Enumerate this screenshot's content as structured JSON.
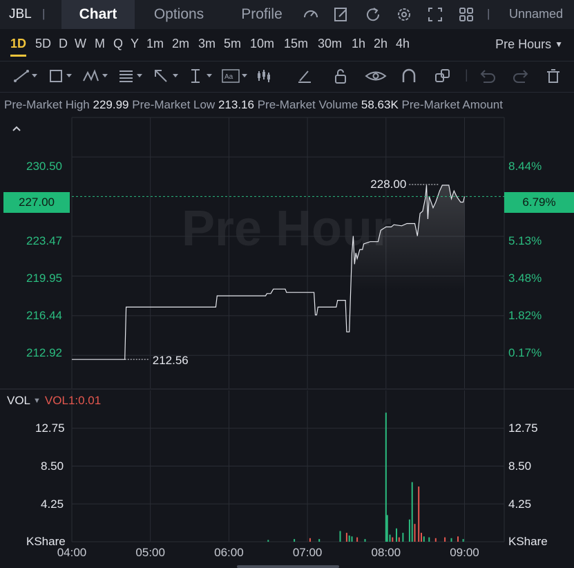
{
  "header": {
    "symbol": "JBL",
    "tabs": [
      {
        "label": "Chart",
        "active": true
      },
      {
        "label": "Options",
        "active": false
      },
      {
        "label": "Profile",
        "active": false
      }
    ],
    "icons": [
      "gauge-icon",
      "edit-icon",
      "refresh-icon",
      "settings-icon",
      "fullscreen-icon",
      "layout-grid-icon"
    ],
    "layout_name": "Unnamed"
  },
  "timeframes": {
    "items": [
      "1D",
      "5D",
      "D",
      "W",
      "M",
      "Q",
      "Y",
      "1m",
      "2m",
      "3m",
      "5m",
      "10m",
      "15m",
      "30m",
      "1h",
      "2h",
      "4h"
    ],
    "active": "1D",
    "session": "Pre Hours"
  },
  "drawing_tools": [
    "trendline-tool-icon",
    "rectangle-tool-icon",
    "pattern-tool-icon",
    "fib-tool-icon",
    "arrow-tool-icon",
    "measure-tool-icon",
    "text-tool-icon",
    "indicator-tool-icon",
    "brush-icon",
    "unlock-icon",
    "eye-icon",
    "magnet-icon",
    "clone-icon",
    "undo-icon",
    "redo-icon",
    "trash-icon"
  ],
  "stats": {
    "high_label": "Pre-Market High",
    "high_value": "229.99",
    "low_label": "Pre-Market Low",
    "low_value": "213.16",
    "volume_label": "Pre-Market Volume",
    "volume_value": "58.63K",
    "amount_label": "Pre-Market Amount"
  },
  "chart_data": {
    "type": "line",
    "watermark": "Pre Hour",
    "current_price": "227.00",
    "current_change": "6.79%",
    "high_marker": "228.00",
    "low_marker": "212.56",
    "price_ticks": [
      "230.50",
      "223.47",
      "219.95",
      "216.44",
      "212.92"
    ],
    "percent_ticks": [
      "8.44%",
      "5.13%",
      "3.48%",
      "1.82%",
      "0.17%"
    ],
    "ylim": [
      210.0,
      234.0
    ],
    "x_ticks": [
      "04:00",
      "05:00",
      "06:00",
      "07:00",
      "08:00",
      "09:00"
    ],
    "x_minutes_range": [
      0,
      330
    ],
    "price_series": [
      [
        0,
        212.56
      ],
      [
        40.5,
        212.56
      ],
      [
        41.5,
        217.2
      ],
      [
        110,
        217.2
      ],
      [
        111,
        218.2
      ],
      [
        148,
        218.2
      ],
      [
        149,
        218.4
      ],
      [
        152,
        218.4
      ],
      [
        154,
        218.8
      ],
      [
        163,
        218.8
      ],
      [
        164,
        218.5
      ],
      [
        185,
        218.5
      ],
      [
        186,
        216.5
      ],
      [
        187,
        216.5
      ],
      [
        188,
        217.2
      ],
      [
        202,
        217.2
      ],
      [
        203,
        217.8
      ],
      [
        209,
        217.8
      ],
      [
        210,
        215.0
      ],
      [
        212,
        215.0
      ],
      [
        214,
        222.0
      ],
      [
        215,
        223.5
      ],
      [
        216,
        221.0
      ],
      [
        217,
        222.0
      ],
      [
        218,
        221.5
      ],
      [
        220,
        222.3
      ],
      [
        222,
        222.3
      ],
      [
        223,
        222.8
      ],
      [
        228,
        223.0
      ],
      [
        234,
        223.0
      ],
      [
        236,
        224.0
      ],
      [
        240,
        224.3
      ],
      [
        244,
        224.3
      ],
      [
        246,
        224.5
      ],
      [
        252,
        224.4
      ],
      [
        256,
        224.6
      ],
      [
        262,
        224.6
      ],
      [
        264,
        223.5
      ],
      [
        266,
        225.5
      ],
      [
        268,
        225.7
      ],
      [
        270,
        226.8
      ],
      [
        271,
        228.0
      ],
      [
        272,
        225.0
      ],
      [
        273,
        227.0
      ],
      [
        276,
        226.0
      ],
      [
        278,
        226.5
      ],
      [
        281,
        227.5
      ],
      [
        283,
        228.0
      ],
      [
        288,
        228.0
      ],
      [
        290,
        226.8
      ],
      [
        292,
        227.5
      ],
      [
        294,
        227.0
      ],
      [
        297,
        226.5
      ],
      [
        299,
        226.5
      ],
      [
        300,
        227.0
      ]
    ],
    "volume_ticks": [
      "12.75",
      "8.50",
      "4.25"
    ],
    "volume_unit": "KShare",
    "volume_legend": "VOL",
    "volume_legend_value": "VOL1:0.01",
    "volume_ylim": [
      0,
      17.0
    ],
    "volume_bars": [
      {
        "t": 150,
        "v": 0.2,
        "dir": "up"
      },
      {
        "t": 170,
        "v": 0.3,
        "dir": "up"
      },
      {
        "t": 182,
        "v": 0.4,
        "dir": "down"
      },
      {
        "t": 189,
        "v": 0.3,
        "dir": "up"
      },
      {
        "t": 205,
        "v": 1.2,
        "dir": "up"
      },
      {
        "t": 210,
        "v": 1.0,
        "dir": "down"
      },
      {
        "t": 212,
        "v": 0.7,
        "dir": "up"
      },
      {
        "t": 214,
        "v": 0.6,
        "dir": "up"
      },
      {
        "t": 218,
        "v": 0.5,
        "dir": "down"
      },
      {
        "t": 224,
        "v": 0.3,
        "dir": "up"
      },
      {
        "t": 240,
        "v": 14.5,
        "dir": "up"
      },
      {
        "t": 241,
        "v": 3.0,
        "dir": "up"
      },
      {
        "t": 243,
        "v": 0.8,
        "dir": "up"
      },
      {
        "t": 245,
        "v": 0.5,
        "dir": "down"
      },
      {
        "t": 248,
        "v": 1.5,
        "dir": "up"
      },
      {
        "t": 250,
        "v": 0.5,
        "dir": "down"
      },
      {
        "t": 253,
        "v": 1.0,
        "dir": "up"
      },
      {
        "t": 258,
        "v": 2.5,
        "dir": "up"
      },
      {
        "t": 260,
        "v": 6.7,
        "dir": "up"
      },
      {
        "t": 262,
        "v": 2.0,
        "dir": "down"
      },
      {
        "t": 265,
        "v": 6.2,
        "dir": "down"
      },
      {
        "t": 267,
        "v": 1.0,
        "dir": "down"
      },
      {
        "t": 269,
        "v": 0.6,
        "dir": "up"
      },
      {
        "t": 273,
        "v": 0.5,
        "dir": "up"
      },
      {
        "t": 278,
        "v": 0.4,
        "dir": "down"
      },
      {
        "t": 285,
        "v": 0.5,
        "dir": "down"
      },
      {
        "t": 290,
        "v": 0.4,
        "dir": "up"
      },
      {
        "t": 295,
        "v": 0.6,
        "dir": "down"
      },
      {
        "t": 299,
        "v": 0.3,
        "dir": "up"
      }
    ],
    "colors": {
      "up": "#2bbd80",
      "down": "#e5584f",
      "line": "#e6e8ee",
      "grid": "#2a2d35",
      "accent": "#f3c53b"
    }
  }
}
